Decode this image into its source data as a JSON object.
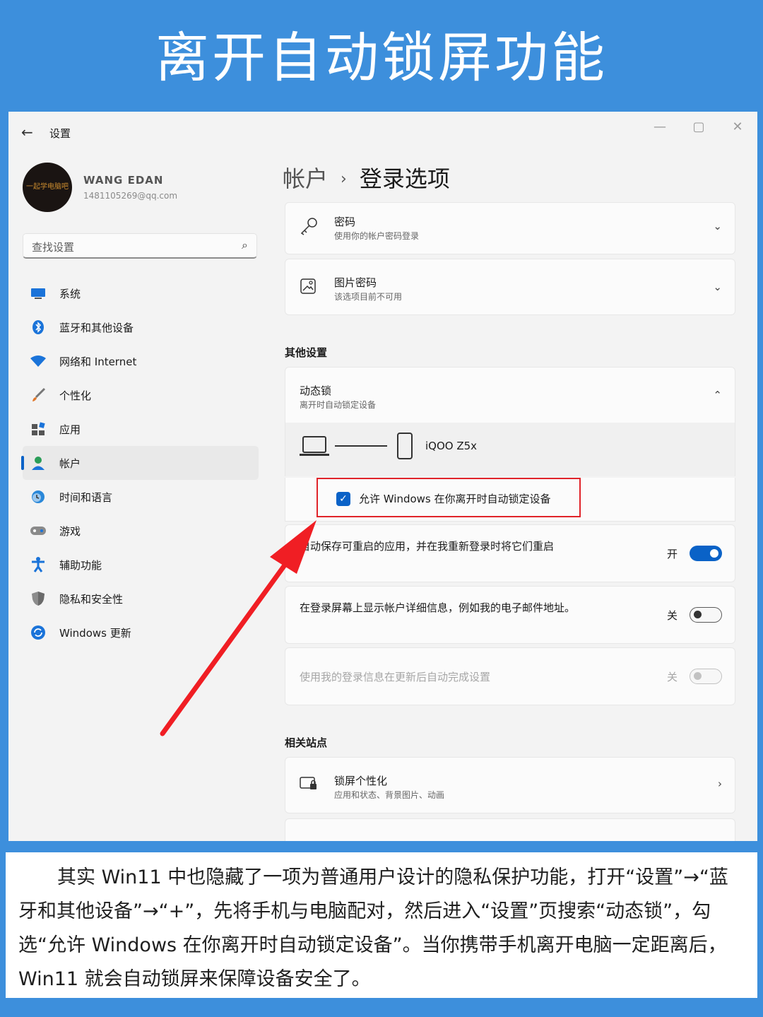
{
  "banner": {
    "title": "离开自动锁屏功能"
  },
  "window": {
    "app_title": "设置",
    "controls": {
      "min": "—",
      "max": "▢",
      "close": "✕"
    },
    "user": {
      "name": "WANG EDAN",
      "email": "1481105269@qq.com",
      "avatar_text": "一起学电脑吧"
    },
    "search": {
      "placeholder": "查找设置"
    },
    "nav": [
      {
        "label": "系统",
        "icon": "monitor-icon",
        "selected": false
      },
      {
        "label": "蓝牙和其他设备",
        "icon": "bluetooth-icon",
        "selected": false
      },
      {
        "label": "网络和 Internet",
        "icon": "wifi-icon",
        "selected": false
      },
      {
        "label": "个性化",
        "icon": "brush-icon",
        "selected": false
      },
      {
        "label": "应用",
        "icon": "apps-icon",
        "selected": false
      },
      {
        "label": "帐户",
        "icon": "account-icon",
        "selected": true
      },
      {
        "label": "时间和语言",
        "icon": "clock-globe-icon",
        "selected": false
      },
      {
        "label": "游戏",
        "icon": "gamepad-icon",
        "selected": false
      },
      {
        "label": "辅助功能",
        "icon": "accessibility-icon",
        "selected": false
      },
      {
        "label": "隐私和安全性",
        "icon": "shield-icon",
        "selected": false
      },
      {
        "label": "Windows 更新",
        "icon": "update-icon",
        "selected": false
      }
    ],
    "breadcrumb": {
      "parent": "帐户",
      "separator": "›",
      "current": "登录选项"
    },
    "password": {
      "title": "密码",
      "subtitle": "使用你的帐户密码登录"
    },
    "picture_password": {
      "title": "图片密码",
      "subtitle": "该选项目前不可用"
    },
    "other_settings": {
      "title": "其他设置"
    },
    "dynamic_lock": {
      "title": "动态锁",
      "subtitle": "离开时自动锁定设备",
      "device_name": "iQOO Z5x",
      "checkbox_label": "允许 Windows 在你离开时自动锁定设备",
      "checked": true
    },
    "settings_rows": [
      {
        "text": "自动保存可重启的应用，并在我重新登录时将它们重启",
        "state": "开",
        "on": true,
        "enabled": true
      },
      {
        "text": "在登录屏幕上显示帐户详细信息，例如我的电子邮件地址。",
        "state": "关",
        "on": false,
        "enabled": true
      },
      {
        "text": "使用我的登录信息在更新后自动完成设置",
        "state": "关",
        "on": false,
        "enabled": false
      }
    ],
    "related": {
      "title": "相关站点",
      "lock_screen": {
        "title": "锁屏个性化",
        "subtitle": "应用和状态、背景图片、动画"
      }
    }
  },
  "caption": {
    "text": "其实 Win11 中也隐藏了一项为普通用户设计的隐私保护功能，打开“设置”→“蓝牙和其他设备”→“+”，先将手机与电脑配对，然后进入“设置”页搜索“动态锁”，勾选“允许 Windows 在你离开时自动锁定设备”。当你携带手机离开电脑一定距离后，Win11 就会自动锁屏来保障设备安全了。"
  },
  "colors": {
    "banner": "#3d8fdc",
    "accent": "#0a62c7",
    "highlight": "#e0242a",
    "arrow": "#f01e24"
  }
}
